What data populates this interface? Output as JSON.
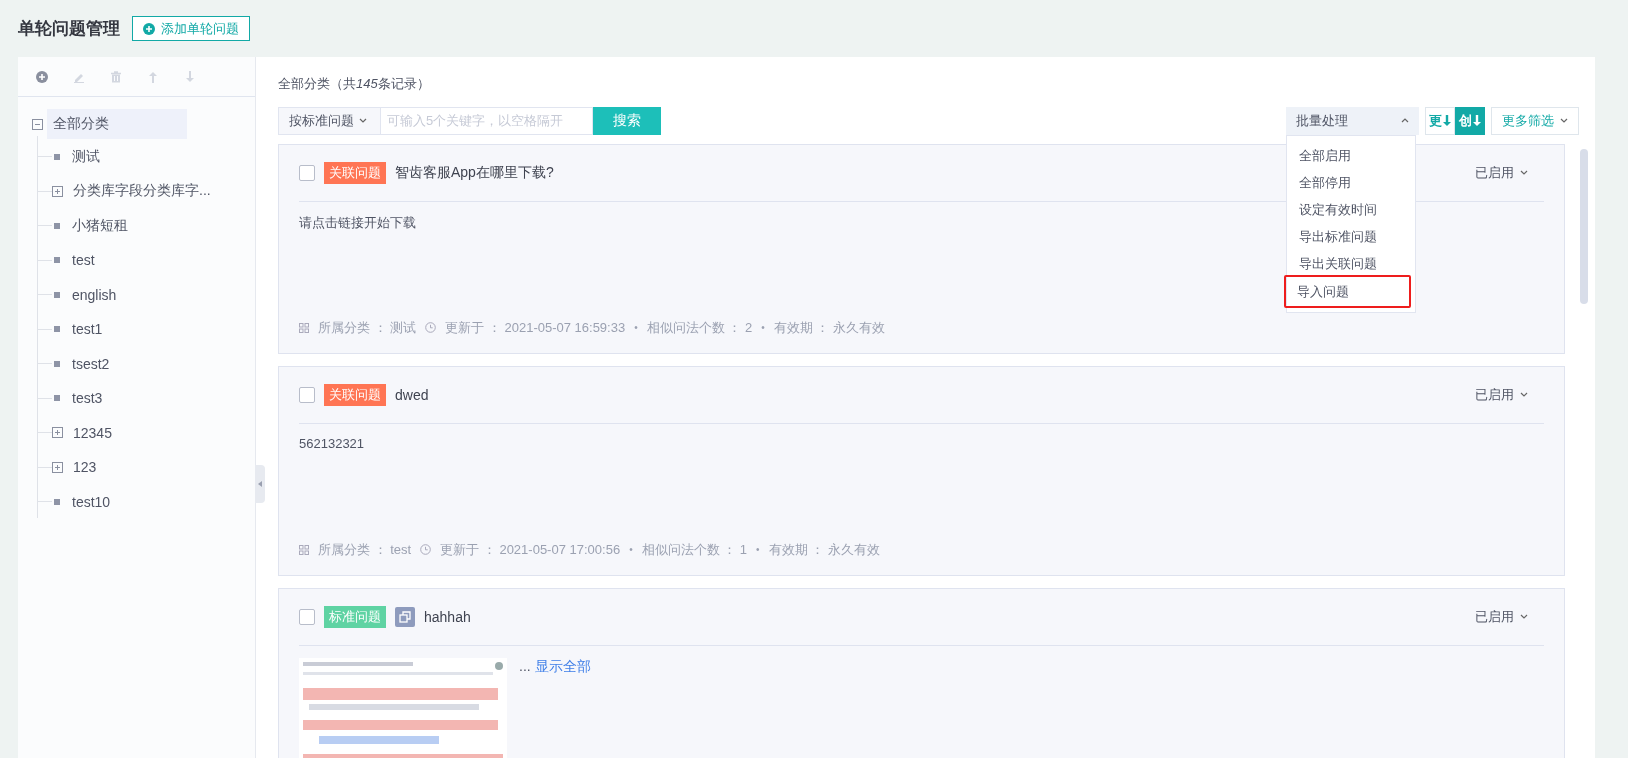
{
  "header": {
    "title": "单轮问题管理",
    "add_button": "添加单轮问题"
  },
  "sidebar": {
    "toolbar": [
      {
        "kind": "add",
        "disabled": false
      },
      {
        "kind": "edit",
        "disabled": true
      },
      {
        "kind": "delete",
        "disabled": true
      },
      {
        "kind": "up",
        "disabled": true
      },
      {
        "kind": "down",
        "disabled": true
      }
    ],
    "tree": [
      {
        "label": "全部分类",
        "kind": "folder",
        "expanded": true,
        "selected": true,
        "children": [
          {
            "label": "测试",
            "kind": "leaf",
            "selected": false
          },
          {
            "label": "分类库字段分类库字...",
            "kind": "folder",
            "expanded": false,
            "selected": false
          },
          {
            "label": "小猪短租",
            "kind": "leaf",
            "selected": false
          },
          {
            "label": "test",
            "kind": "leaf",
            "selected": false
          },
          {
            "label": "english",
            "kind": "leaf",
            "selected": false
          },
          {
            "label": "test1",
            "kind": "leaf",
            "selected": false
          },
          {
            "label": "tsest2",
            "kind": "leaf",
            "selected": false
          },
          {
            "label": "test3",
            "kind": "leaf",
            "selected": false
          },
          {
            "label": "12345",
            "kind": "folder",
            "expanded": false,
            "selected": false
          },
          {
            "label": "123",
            "kind": "folder",
            "expanded": false,
            "selected": false
          },
          {
            "label": "test10",
            "kind": "leaf",
            "selected": false
          }
        ]
      }
    ]
  },
  "main": {
    "summary": {
      "prefix": "全部分类（共",
      "count": "145",
      "suffix": "条记录）"
    },
    "search": {
      "mode": "按标准问题",
      "placeholder": "可输入5个关键字，以空格隔开",
      "button": "搜索"
    },
    "batch": {
      "label": "批量处理",
      "expanded": true,
      "menu": [
        {
          "label": "全部启用",
          "highlighted": false
        },
        {
          "label": "全部停用",
          "highlighted": false
        },
        {
          "label": "设定有效时间",
          "highlighted": false
        },
        {
          "label": "导出标准问题",
          "highlighted": false
        },
        {
          "label": "导出关联问题",
          "highlighted": false
        },
        {
          "label": "导入问题",
          "highlighted": true
        }
      ]
    },
    "sort_buttons": [
      {
        "label": "更",
        "selected": false
      },
      {
        "label": "创",
        "selected": true
      }
    ],
    "filter": "更多筛选",
    "cards": [
      {
        "checked": false,
        "tag": {
          "label": "关联问题",
          "kind": "related"
        },
        "copy": false,
        "title": "智齿客服App在哪里下载?",
        "status": "已启用",
        "body": {
          "kind": "text",
          "text": "请点击链接开始下载"
        },
        "meta": [
          {
            "kind": "category",
            "text": "所属分类 ： 测试"
          },
          {
            "kind": "time",
            "text": "更新于 ： 2021-05-07 16:59:33"
          },
          {
            "kind": "sep",
            "text": "•"
          },
          {
            "kind": "plain",
            "text": "相似问法个数 ： 2"
          },
          {
            "kind": "sep",
            "text": "•"
          },
          {
            "kind": "plain",
            "text": "有效期 ： 永久有效"
          }
        ]
      },
      {
        "checked": false,
        "tag": {
          "label": "关联问题",
          "kind": "related"
        },
        "copy": false,
        "title": "dwed",
        "status": "已启用",
        "body": {
          "kind": "text",
          "text": "562132321"
        },
        "meta": [
          {
            "kind": "category",
            "text": "所属分类 ： test"
          },
          {
            "kind": "time",
            "text": "更新于 ： 2021-05-07 17:00:56"
          },
          {
            "kind": "sep",
            "text": "•"
          },
          {
            "kind": "plain",
            "text": "相似问法个数 ： 1"
          },
          {
            "kind": "sep",
            "text": "•"
          },
          {
            "kind": "plain",
            "text": "有效期 ： 永久有效"
          }
        ]
      },
      {
        "checked": false,
        "tag": {
          "label": "标准问题",
          "kind": "standard"
        },
        "copy": true,
        "title": "hahhah",
        "status": "已启用",
        "body": {
          "kind": "picture",
          "ellipsis": "...",
          "link": "显示全部"
        }
      }
    ]
  }
}
